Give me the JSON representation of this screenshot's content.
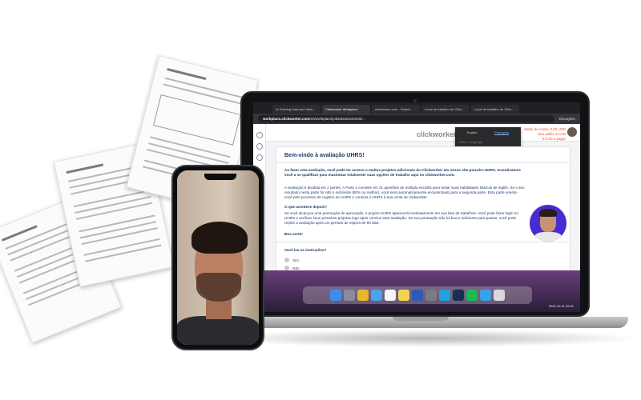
{
  "browser": {
    "tabs": [
      "AI Training Data and other...",
      "Clickworker Workplace",
      "clickworker.com - Search",
      "Local de trabalho do Click...",
      "Local de trabalho do Click..."
    ],
    "url_domain": "workplace.clickworker.com",
    "url_rest": "/en/workplace/jobs/assessments/...",
    "profile": "Dscognito"
  },
  "header": {
    "logo": "clickworker",
    "account_lines": [
      "Saldo de conta: 0,00 USD",
      "Seu saldo: € 0,00",
      "€ 0,00 a pagar"
    ],
    "language_options": [
      "English",
      "Português"
    ],
    "language_selected": "Português",
    "language_hint": "Select Language"
  },
  "card": {
    "title": "Bem-vindo à avaliação UHRS!",
    "intro": "Ao fazer esta avaliação, você pode ter acesso a muitos projetos adicionais do Clickworker em nosso site parceiro UHRS. Incentivamos você a se qualificar para maximizar totalmente suas opções de trabalho aqui no clickworker.com.",
    "body1": "A avaliação é dividida em 2 partes. A Parte 1 consiste em 21 questões de múltipla escolha para testar suas habilidades básicas de inglês. Se o seu resultado nesta parte for alto o suficiente (80% ou melhor), você será automaticamente encaminhado para a segunda parte. Esta parte orienta você pelo processo de registro do UHRS e conecta o UHRS à sua conta de clickworker.",
    "subhead": "O que acontece depois?",
    "body2": "Se você alcançou uma pontuação de aprovação, o projeto UHRS aparecerá imediatamente em sua lista de trabalhos. Você pode fazer login no UHRS e verificar seus primeiros projetos logo após concluir esta avaliação. Se sua pontuação não foi boa o suficiente para passar, você pode repetir a avaliação após um período de espera de 90 dias.",
    "good_luck": "Boa sorte!",
    "question": "Você leu as instruções?",
    "options": [
      "Sim",
      "Não"
    ]
  },
  "dock": {
    "clock": "2022-10-11 09:41"
  },
  "colors": {
    "brand_orange": "#e6532b",
    "text_navy": "#1f3a68",
    "webcam_bg": "#4a2bd1"
  }
}
